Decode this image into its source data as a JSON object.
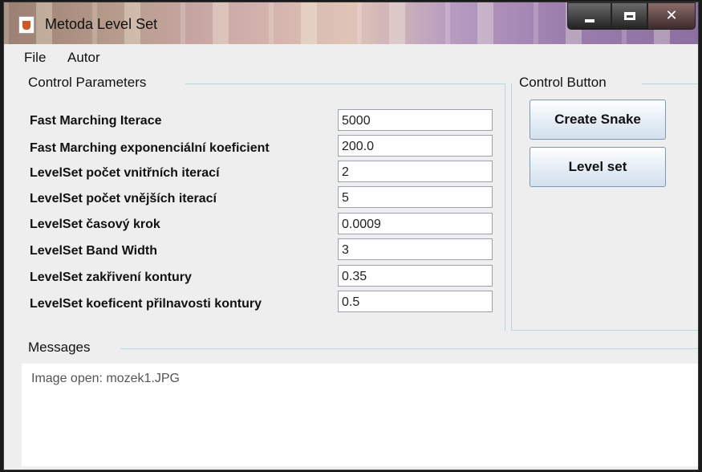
{
  "window": {
    "title": "Metoda Level Set"
  },
  "menu": [
    "File",
    "Autor"
  ],
  "control_parameters": {
    "title": "Control Parameters",
    "params": [
      {
        "label": "Fast Marching Iterace",
        "value": "5000"
      },
      {
        "label": "Fast Marching exponenciální koeficient",
        "value": "200.0"
      },
      {
        "label": "LevelSet počet vnitřních iterací",
        "value": "2"
      },
      {
        "label": "LevelSet počet vnějších iterací",
        "value": "5"
      },
      {
        "label": "LevelSet časový krok",
        "value": "0.0009"
      },
      {
        "label": "LevelSet Band Width",
        "value": "3"
      },
      {
        "label": "LevelSet zakřivení kontury",
        "value": "0.35"
      },
      {
        "label": "LevelSet koeficent přilnavosti kontury",
        "value": "0.5"
      }
    ]
  },
  "control_button": {
    "title": "Control Button",
    "create_snake": "Create Snake",
    "level_set": "Level set"
  },
  "messages": {
    "title": "Messages",
    "text": "Image open: mozek1.JPG"
  }
}
